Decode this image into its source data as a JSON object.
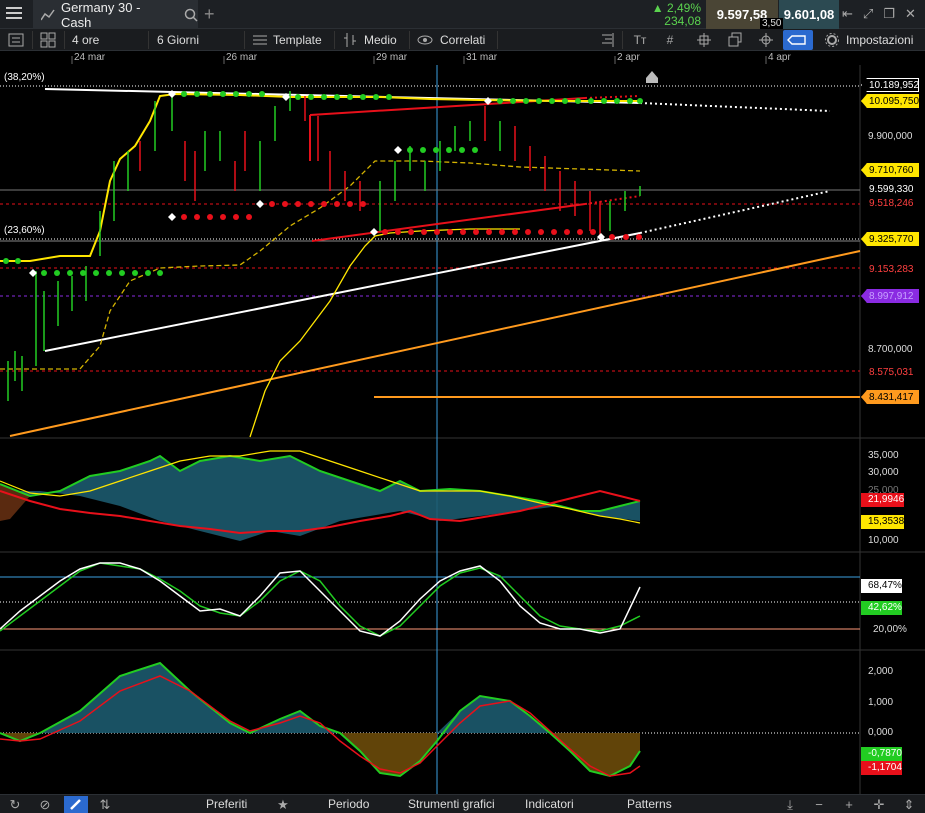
{
  "window": {
    "tab_title": "Germany 30 - Cash"
  },
  "quote": {
    "change_pct": "2,49%",
    "change_abs": "234,08",
    "bid": "9.597,58",
    "ask": "9.601,08",
    "spread": "3,50"
  },
  "toolbar": {
    "interval": "4 ore",
    "range": "6 Giorni",
    "template": "Template",
    "medio": "Medio",
    "correlati": "Correlati",
    "settings": "Impostazioni"
  },
  "dates": [
    "24 mar",
    "26 mar",
    "29 mar",
    "31 mar",
    "2 apr",
    "4 apr"
  ],
  "main_axis": {
    "labels": [
      "9.900,000",
      "8.700,000"
    ]
  },
  "fib_labels": [
    "(38,20%)",
    "(23,60%)"
  ],
  "price_tags": [
    {
      "text": "10.189,952",
      "bg": "#000000",
      "fg": "#ffffff",
      "border": "#ffffff"
    },
    {
      "text": "10.095,750",
      "bg": "#ffe600",
      "fg": "#000000",
      "border": "#ffe600"
    },
    {
      "text": "9.710,760",
      "bg": "#ffe600",
      "fg": "#000000",
      "border": "#ffe600"
    },
    {
      "text": "9.599,330",
      "bg": "#000000",
      "fg": "#ffffff",
      "border": "#000000"
    },
    {
      "text": "9.518,246",
      "bg": "#000000",
      "fg": "#ff4040",
      "border": "#000000"
    },
    {
      "text": "9.325,770",
      "bg": "#ffe600",
      "fg": "#000000",
      "border": "#ffe600"
    },
    {
      "text": "9.153,283",
      "bg": "#000000",
      "fg": "#ff4040",
      "border": "#000000"
    },
    {
      "text": "8.997,912",
      "bg": "#8a2be2",
      "fg": "#c7a0ff",
      "border": "#8a2be2"
    },
    {
      "text": "8.575,031",
      "bg": "#000000",
      "fg": "#ff4040",
      "border": "#000000"
    },
    {
      "text": "8.431,417",
      "bg": "#ff9a1e",
      "fg": "#000000",
      "border": "#ff9a1e"
    }
  ],
  "adx_panel": {
    "axis": [
      "35,000",
      "30,000",
      "25,000",
      "10,000"
    ],
    "tags": [
      {
        "text": "21,9946",
        "bg": "#e8101a",
        "fg": "#ffffff"
      },
      {
        "text": "15,3538",
        "bg": "#ffe600",
        "fg": "#000000"
      }
    ]
  },
  "stoch_panel": {
    "tags": [
      {
        "text": "68,47%",
        "bg": "#ffffff",
        "fg": "#000000"
      },
      {
        "text": "42,62%",
        "bg": "#22cc22",
        "fg": "#ffffff"
      }
    ],
    "axis": [
      "20,00%"
    ]
  },
  "macd_panel": {
    "axis": [
      "2,000",
      "1,000",
      "0,000"
    ],
    "tags": [
      {
        "text": "-0,7870",
        "bg": "#22cc22",
        "fg": "#ffffff"
      },
      {
        "text": "-1,1704",
        "bg": "#e8101a",
        "fg": "#ffffff"
      }
    ]
  },
  "bottombar": {
    "preferiti": "Preferiti",
    "periodo": "Periodo",
    "strumenti": "Strumenti grafici",
    "indicatori": "Indicatori",
    "patterns": "Patterns"
  },
  "colors": {
    "up": "#22cc22",
    "down": "#e8101a",
    "accent": "#2b6acf",
    "fib": "#ffe600",
    "trend": "#ff9a1e"
  }
}
